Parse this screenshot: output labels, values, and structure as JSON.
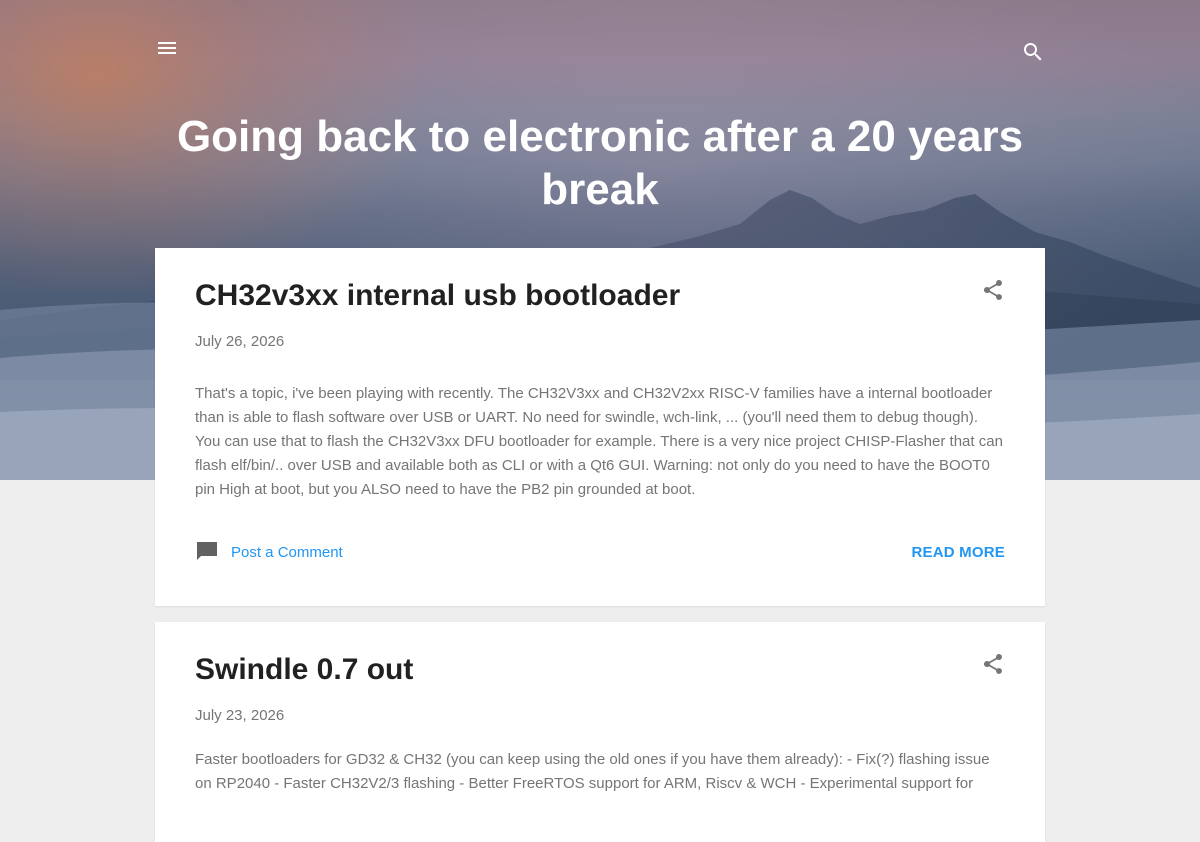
{
  "header": {
    "blog_title": "Going back to electronic after a 20 years break",
    "menu_icon": "menu-icon",
    "search_icon": "search-icon"
  },
  "posts": [
    {
      "title": "CH32v3xx internal usb bootloader",
      "date": "July 26, 2026",
      "snippet": " That's a topic,  i've been playing with recently. The CH32V3xx and CH32V2xx RISC-V families have a internal bootloader than is able to flash software over USB or UART. No need for swindle, wch-link, ... (you'll need them to debug though). You can use that to flash the CH32V3xx DFU bootloader for example. There is a very nice project   CHISP-Flasher  that can flash elf/bin/.. over USB and available both as CLI or with a Qt6 GUI. Warning: not only do you need to have the BOOT0 pin High at boot, but you ALSO need to have the PB2  pin grounded at boot.",
      "comment_label": "Post a Comment",
      "read_more_label": "READ MORE",
      "share_icon": "share-icon",
      "comment_icon": "comment-icon"
    },
    {
      "title": "Swindle 0.7 out",
      "date": "July 23, 2026",
      "snippet": "  Faster bootloaders for GD32 & CH32 (you can keep using the old ones if you have them already): - Fix(?) flashing issue on RP2040 - Faster CH32V2/3 flashing - Better FreeRTOS support for ARM, Riscv & WCH - Experimental support for",
      "share_icon": "share-icon"
    }
  ],
  "colors": {
    "accent": "#2196f3",
    "title_text": "#212121",
    "body_text": "#757575",
    "page_background": "#eeeeee"
  }
}
